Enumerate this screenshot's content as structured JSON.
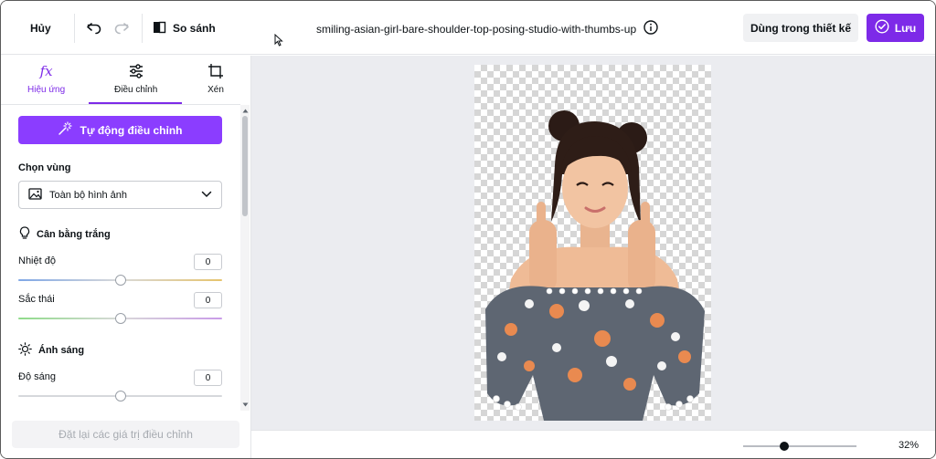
{
  "topbar": {
    "cancel_label": "Hủy",
    "compare_label": "So sánh",
    "filename": "smiling-asian-girl-bare-shoulder-top-posing-studio-with-thumbs-up",
    "use_in_design_label": "Dùng trong thiết kế",
    "save_label": "Lưu"
  },
  "tabs": [
    {
      "label": "Hiệu ứng",
      "icon": "fx-icon"
    },
    {
      "label": "Điều chỉnh",
      "icon": "sliders-icon"
    },
    {
      "label": "Xén",
      "icon": "crop-icon"
    }
  ],
  "panel": {
    "auto_adjust_label": "Tự động điều chỉnh",
    "select_area_label": "Chọn vùng",
    "select_area_value": "Toàn bộ hình ảnh",
    "white_balance_heading": "Cân bằng trắng",
    "temperature_label": "Nhiệt độ",
    "temperature_value": "0",
    "tint_label": "Sắc thái",
    "tint_value": "0",
    "light_heading": "Ánh sáng",
    "brightness_label": "Độ sáng",
    "brightness_value": "0",
    "reset_label": "Đặt lại các giá trị điều chỉnh"
  },
  "sliders": {
    "temperature_level": 0.5,
    "tint_level": 0.5,
    "brightness_level": 0.5
  },
  "zoom": {
    "label": "32%",
    "level": 0.36
  },
  "colors": {
    "accent": "#7d2ae8",
    "auto_button": "#8b3dff",
    "canvas_bg": "#ebecf0"
  }
}
